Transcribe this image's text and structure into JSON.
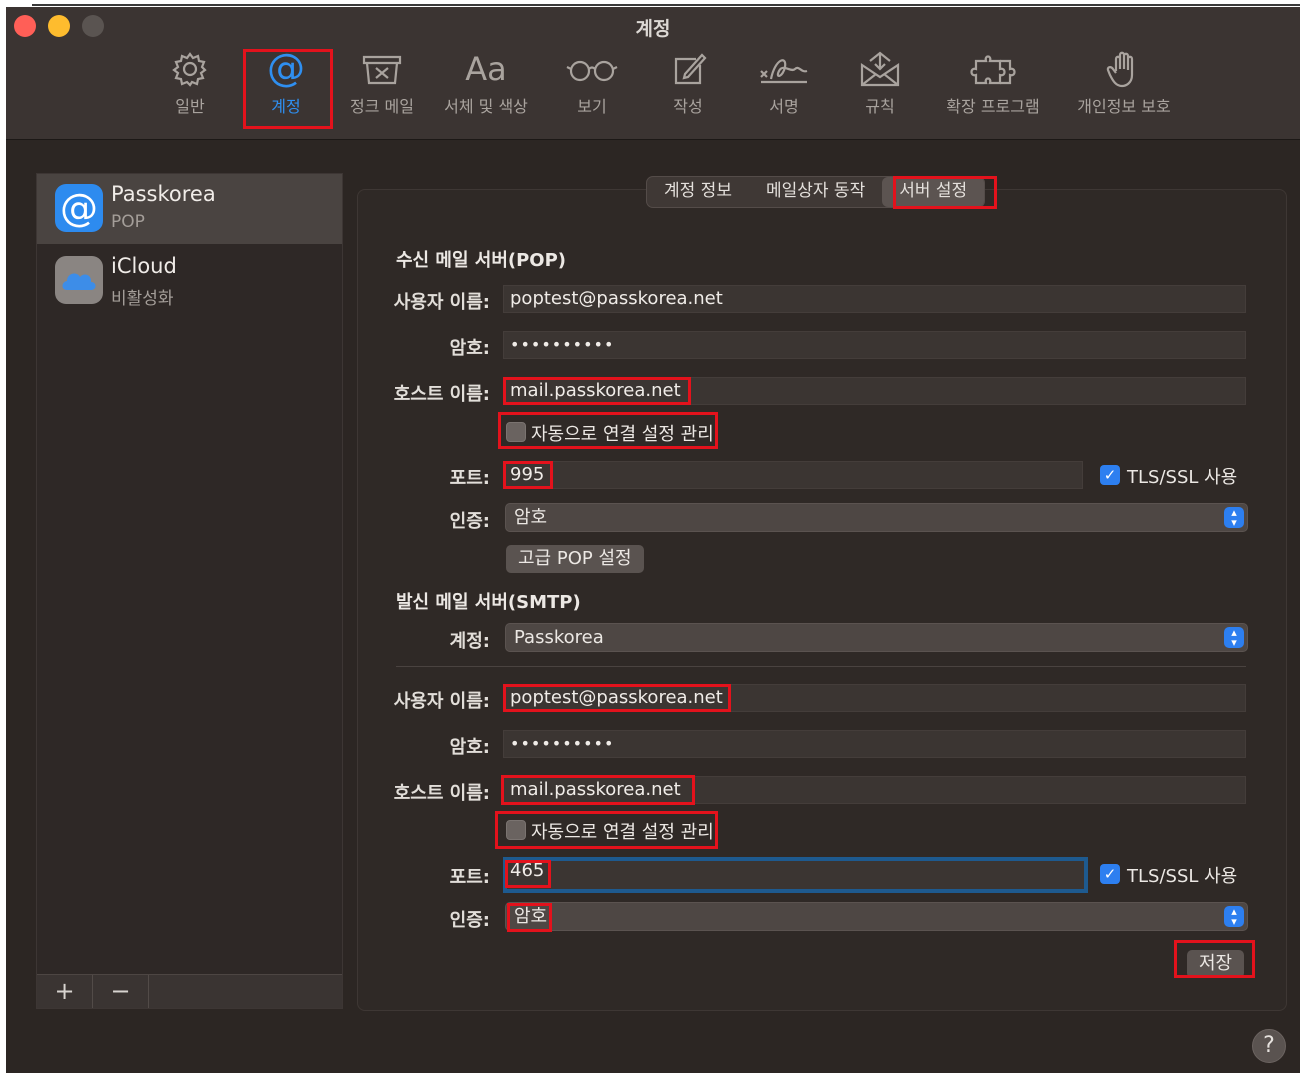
{
  "window": {
    "title": "계정"
  },
  "toolbar": {
    "items": [
      {
        "label": "일반",
        "icon": "gear-icon"
      },
      {
        "label": "계정",
        "icon": "at-icon"
      },
      {
        "label": "정크 메일",
        "icon": "junk-trash-icon"
      },
      {
        "label": "서체 및 색상",
        "icon": "font-icon",
        "glyph": "Aa"
      },
      {
        "label": "보기",
        "icon": "glasses-icon"
      },
      {
        "label": "작성",
        "icon": "compose-icon"
      },
      {
        "label": "서명",
        "icon": "signature-icon"
      },
      {
        "label": "규칙",
        "icon": "rules-envelope-icon"
      },
      {
        "label": "확장 프로그램",
        "icon": "puzzle-icon"
      },
      {
        "label": "개인정보 보호",
        "icon": "hand-icon"
      }
    ],
    "active_index": 1
  },
  "sidebar": {
    "accounts": [
      {
        "name": "Passkorea",
        "sub": "POP",
        "icon": "at-icon",
        "selected": true
      },
      {
        "name": "iCloud",
        "sub": "비활성화",
        "icon": "icloud-icon",
        "selected": false
      }
    ],
    "add_label": "+",
    "remove_label": "−"
  },
  "tabs": [
    "계정 정보",
    "메일상자 동작",
    "서버 설정"
  ],
  "active_tab": 2,
  "incoming": {
    "title": "수신 메일 서버(POP)",
    "username_label": "사용자 이름:",
    "username": "poptest@passkorea.net",
    "password_label": "암호:",
    "password": "••••••••••",
    "host_label": "호스트 이름:",
    "host": "mail.passkorea.net",
    "auto_manage_label": "자동으로 연결 설정 관리",
    "auto_manage_checked": false,
    "port_label": "포트:",
    "port": "995",
    "tls_label": "TLS/SSL 사용",
    "tls_checked": true,
    "auth_label": "인증:",
    "auth": "암호",
    "advanced_button": "고급 POP 설정"
  },
  "outgoing": {
    "title": "발신 메일 서버(SMTP)",
    "account_label": "계정:",
    "account": "Passkorea",
    "username_label": "사용자 이름:",
    "username": "poptest@passkorea.net",
    "password_label": "암호:",
    "password": "••••••••••",
    "host_label": "호스트 이름:",
    "host": "mail.passkorea.net",
    "auto_manage_label": "자동으로 연결 설정 관리",
    "auto_manage_checked": false,
    "port_label": "포트:",
    "port": "465",
    "tls_label": "TLS/SSL 사용",
    "tls_checked": true,
    "auth_label": "인증:",
    "auth": "암호"
  },
  "save_button": "저장",
  "help_label": "?",
  "colors": {
    "accent": "#2d7ff0",
    "highlight": "#e3121c",
    "window_bg": "#2c2623"
  }
}
